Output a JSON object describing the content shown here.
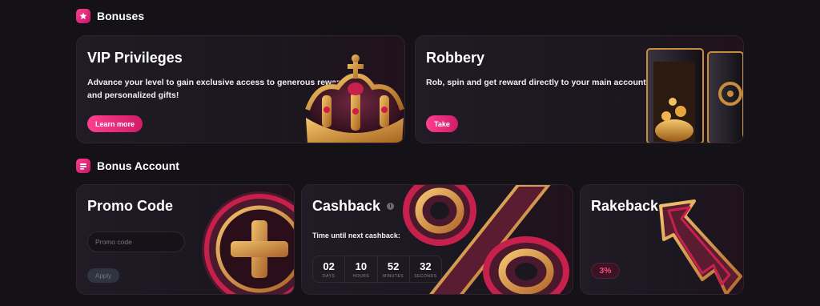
{
  "sections": {
    "bonuses": "Bonuses",
    "bonus_account": "Bonus Account"
  },
  "vip": {
    "title": "VIP Privileges",
    "description_line1": "Advance your level to gain exclusive access to generous rewards",
    "description_line2": "and personalized gifts!",
    "button": "Learn more"
  },
  "robbery": {
    "title": "Robbery",
    "description": "Rob, spin and get reward directly to your main account!",
    "button": "Take"
  },
  "promo": {
    "title": "Promo Code",
    "placeholder": "Promo code",
    "button": "Apply"
  },
  "cashback": {
    "title": "Cashback",
    "timer_label": "Time until next cashback:",
    "timer": [
      {
        "value": "02",
        "unit": "DAYS"
      },
      {
        "value": "10",
        "unit": "HOURS"
      },
      {
        "value": "52",
        "unit": "MINUTES"
      },
      {
        "value": "32",
        "unit": "SECONDS"
      }
    ]
  },
  "rakeback": {
    "title": "Rakeback",
    "percent": "3%"
  },
  "colors": {
    "accent": "#ff3f8e",
    "background": "#141117",
    "gold": "#d9a04a"
  }
}
